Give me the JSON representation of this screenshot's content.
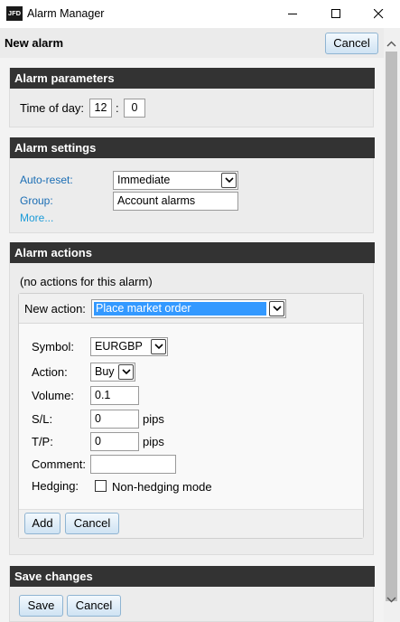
{
  "window": {
    "title": "Alarm Manager",
    "logo_text": "JFD",
    "icons": [
      "minimize-icon",
      "maximize-icon",
      "close-icon"
    ]
  },
  "header": {
    "title": "New alarm",
    "cancel_label": "Cancel"
  },
  "alarm_parameters": {
    "heading": "Alarm parameters",
    "time_label": "Time of day:",
    "hour": "12",
    "separator": ":",
    "minute": "0"
  },
  "alarm_settings": {
    "heading": "Alarm settings",
    "auto_reset_label": "Auto-reset:",
    "auto_reset_value": "Immediate",
    "group_label": "Group:",
    "group_value": "Account alarms",
    "more_link": "More..."
  },
  "alarm_actions": {
    "heading": "Alarm actions",
    "no_actions_text": "(no actions for this alarm)",
    "new_action_label": "New action:",
    "new_action_value": "Place market order",
    "form": {
      "symbol_label": "Symbol:",
      "symbol_value": "EURGBP",
      "action_label": "Action:",
      "action_value": "Buy",
      "volume_label": "Volume:",
      "volume_value": "0.1",
      "sl_label": "S/L:",
      "sl_value": "0",
      "sl_unit": "pips",
      "tp_label": "T/P:",
      "tp_value": "0",
      "tp_unit": "pips",
      "comment_label": "Comment:",
      "comment_value": "",
      "hedging_label": "Hedging:",
      "hedging_checkbox_label": "Non-hedging mode",
      "hedging_checked": false
    },
    "add_label": "Add",
    "cancel_label": "Cancel"
  },
  "save_changes": {
    "heading": "Save changes",
    "save_label": "Save",
    "cancel_label": "Cancel"
  },
  "colors": {
    "section_header_bg": "#333333",
    "link": "#1b9bd8",
    "label_blue": "#1a6db4",
    "selected_option_bg": "#3399ff",
    "button_border": "#8fb4d2"
  }
}
